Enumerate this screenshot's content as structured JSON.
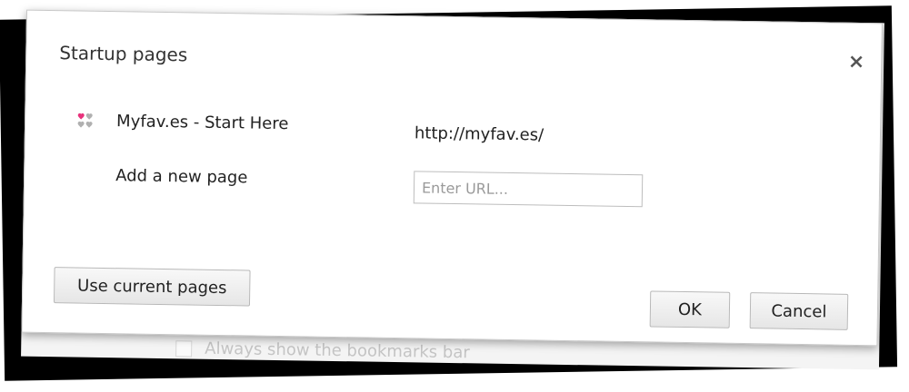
{
  "dialog": {
    "title": "Startup pages",
    "close_glyph": "×",
    "close_icon": "close-icon"
  },
  "startup_list": [
    {
      "favicon": "heart-favicon-icon",
      "name": "Myfav.es - Start Here",
      "url": "http://myfav.es/"
    }
  ],
  "add_page": {
    "label": "Add a new page",
    "placeholder": "Enter URL...",
    "value": ""
  },
  "buttons": {
    "use_current": "Use current pages",
    "ok": "OK",
    "cancel": "Cancel"
  },
  "background": {
    "checkbox_label": "Always show the bookmarks bar"
  },
  "colors": {
    "favicon_pink": "#e8327c",
    "favicon_gray": "#b0b0b0"
  }
}
